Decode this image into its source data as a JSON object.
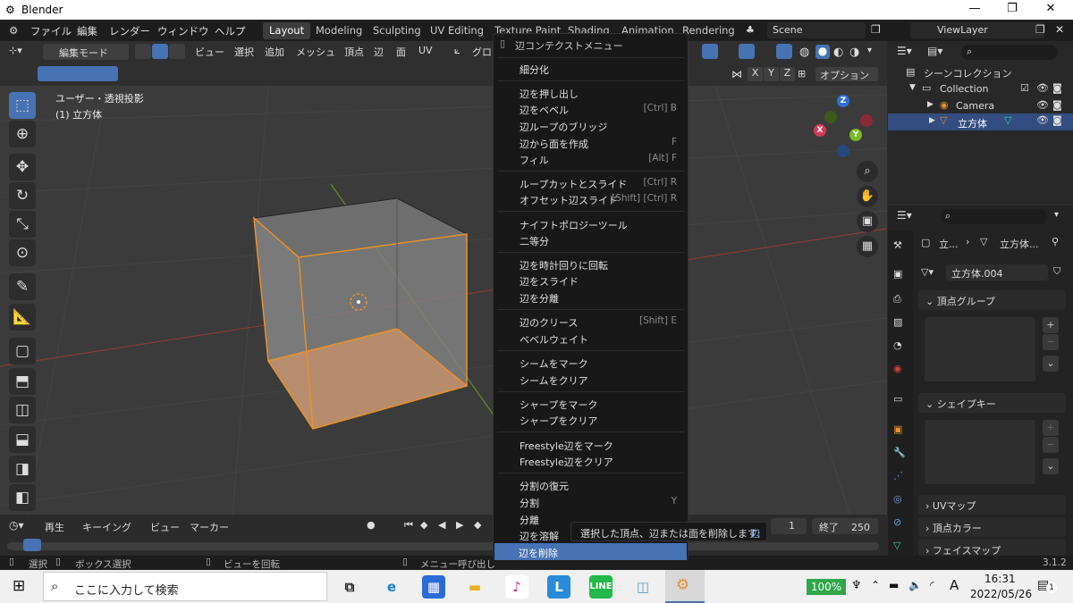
{
  "window": {
    "title": "Blender",
    "controls": [
      "—",
      "❐",
      "✕"
    ]
  },
  "topmenu": {
    "items": [
      "ファイル",
      "編集",
      "レンダー",
      "ウィンドウ",
      "ヘルプ"
    ],
    "workspaces": [
      "Layout",
      "Modeling",
      "Sculpting",
      "UV Editing",
      "Texture Paint",
      "Shading",
      "Animation",
      "Rendering"
    ],
    "scene": "Scene",
    "view_layer": "ViewLayer"
  },
  "viewport_header": {
    "mode": "編集モード",
    "menus": [
      "ビュー",
      "選択",
      "追加",
      "メッシュ",
      "頂点",
      "辺",
      "面",
      "UV"
    ],
    "global": "グロ",
    "options": "オプション",
    "axes": [
      "X",
      "Y",
      "Z"
    ]
  },
  "viewport": {
    "view_name": "ユーザー・透視投影",
    "object_label": "(1) 立方体",
    "gizmo_axes": [
      "X",
      "Y",
      "Z"
    ]
  },
  "context_menu": {
    "title": "辺コンテクストメニュー",
    "items": [
      {
        "label": "細分化",
        "shortcut": ""
      },
      {
        "label": "辺を押し出し",
        "shortcut": ""
      },
      {
        "label": "辺をベベル",
        "shortcut": "[Ctrl] B"
      },
      {
        "label": "辺ループのブリッジ",
        "shortcut": ""
      },
      {
        "label": "辺から面を作成",
        "shortcut": "F"
      },
      {
        "label": "フィル",
        "shortcut": "[Alt] F"
      },
      {
        "label": "ループカットとスライド",
        "shortcut": "[Ctrl] R"
      },
      {
        "label": "オフセット辺スライド",
        "shortcut": "[Shift] [Ctrl] R"
      },
      {
        "label": "ナイフトポロジーツール",
        "shortcut": ""
      },
      {
        "label": "二等分",
        "shortcut": ""
      },
      {
        "label": "辺を時計回りに回転",
        "shortcut": ""
      },
      {
        "label": "辺をスライド",
        "shortcut": ""
      },
      {
        "label": "辺を分離",
        "shortcut": ""
      },
      {
        "label": "辺のクリース",
        "shortcut": "[Shift] E"
      },
      {
        "label": "ベベルウェイト",
        "shortcut": ""
      },
      {
        "label": "シームをマーク",
        "shortcut": ""
      },
      {
        "label": "シームをクリア",
        "shortcut": ""
      },
      {
        "label": "シャープをマーク",
        "shortcut": ""
      },
      {
        "label": "シャープをクリア",
        "shortcut": ""
      },
      {
        "label": "Freestyle辺をマーク",
        "shortcut": ""
      },
      {
        "label": "Freestyle辺をクリア",
        "shortcut": ""
      },
      {
        "label": "分割の復元",
        "shortcut": ""
      },
      {
        "label": "分割",
        "shortcut": "Y"
      },
      {
        "label": "分離",
        "shortcut": "P"
      },
      {
        "label": "辺を溶解",
        "shortcut": ""
      },
      {
        "label": "辺を削除",
        "shortcut": ""
      }
    ],
    "tooltip": "選択した頂点、辺または面を削除します:",
    "tooltip_suffix": "辺"
  },
  "outliner": {
    "root": "シーンコレクション",
    "collection": "Collection",
    "items": [
      "Camera",
      "立方体"
    ]
  },
  "properties": {
    "breadcrumb_a": "立...",
    "breadcrumb_b": "立方体...",
    "mesh_name": "立方体.004",
    "panels": [
      "頂点グループ",
      "シェイプキー",
      "UVマップ",
      "頂点カラー",
      "フェイスマップ"
    ]
  },
  "timeline": {
    "menus": [
      "再生",
      "キーイング",
      "ビュー",
      "マーカー"
    ],
    "frame": "1",
    "end_label": "終了",
    "end": "250"
  },
  "statusbar": {
    "items": [
      "選択",
      "ボックス選択",
      "ビューを回転",
      "メニュー呼び出し"
    ],
    "version": "3.1.2"
  },
  "taskbar": {
    "search_placeholder": "ここに入力して検索",
    "battery": "100%",
    "time": "16:31",
    "date": "2022/05/26",
    "ime": "A",
    "notif": "1"
  },
  "colors": {
    "accent": "#4772b3",
    "orange": "#e8912d"
  }
}
